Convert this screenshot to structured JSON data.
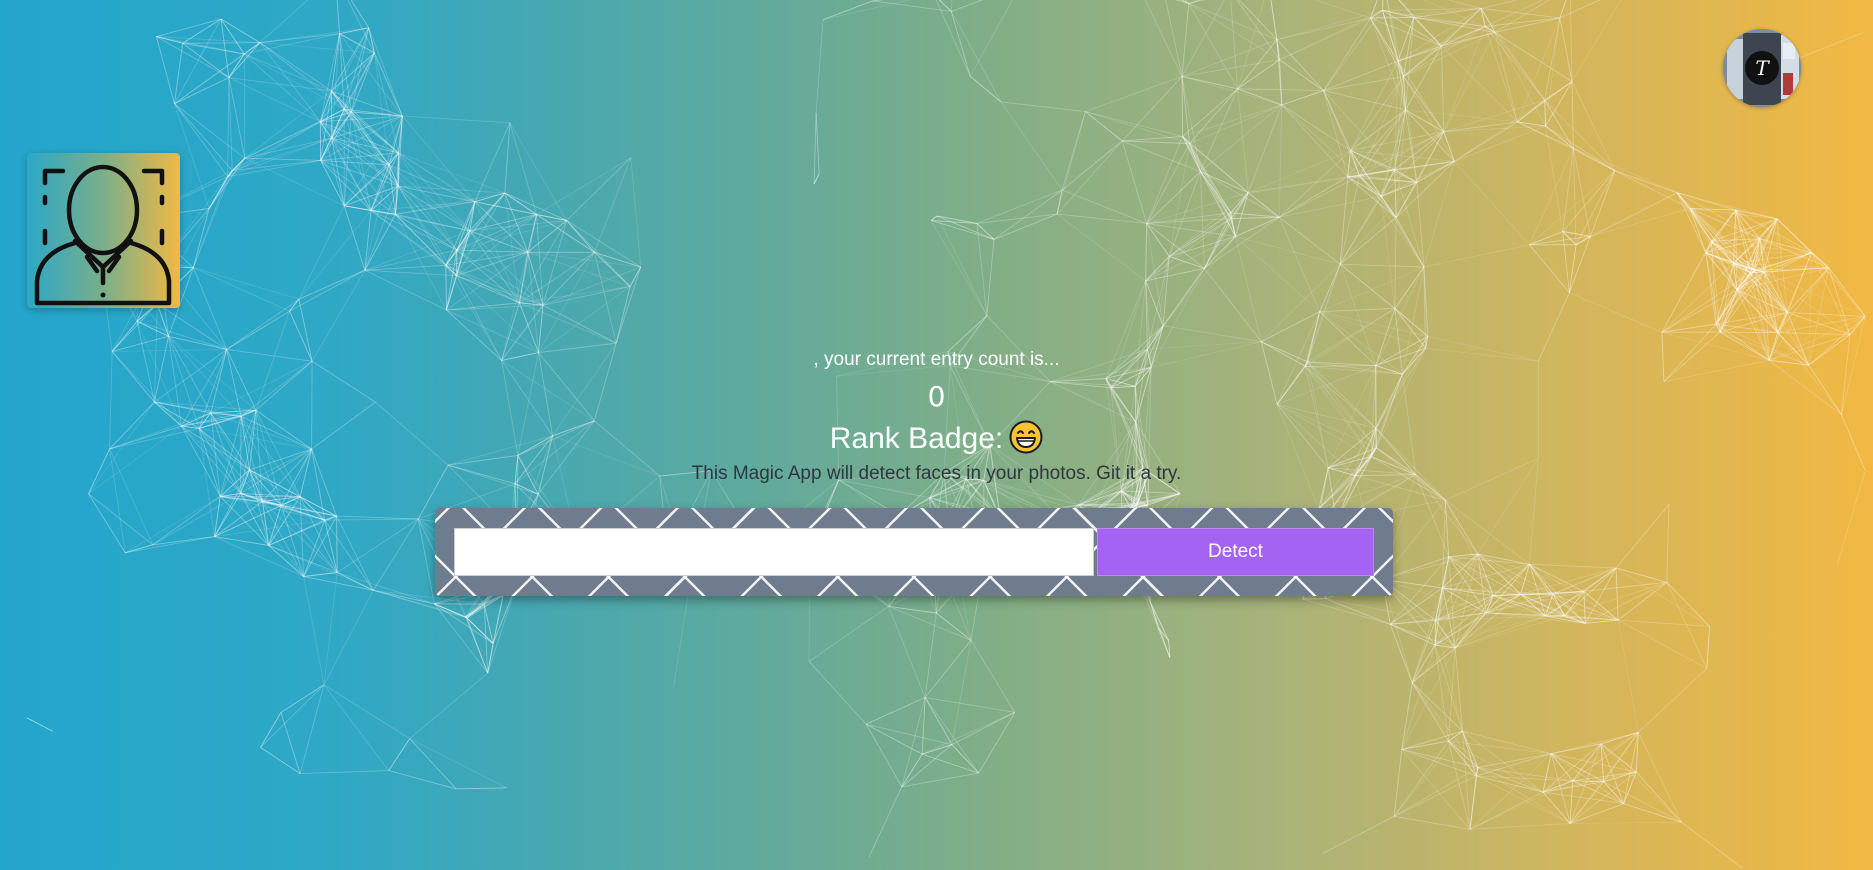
{
  "app": {
    "logo_icon": "face-scan-icon",
    "avatar_icon": "user-avatar",
    "avatar_initial": "T"
  },
  "entry": {
    "message": ", your current entry count is...",
    "count": "0"
  },
  "rank": {
    "label": "Rank Badge:",
    "badge_icon": "grinning-face-emoji"
  },
  "tagline": "This Magic App will detect faces in your photos. Git it a try.",
  "form": {
    "input_value": "",
    "input_placeholder": "",
    "detect_label": "Detect"
  },
  "colors": {
    "gradient_left": "#23a6cb",
    "gradient_right": "#f2b843",
    "button": "#a463f2",
    "panel": "#6f7c8e"
  }
}
